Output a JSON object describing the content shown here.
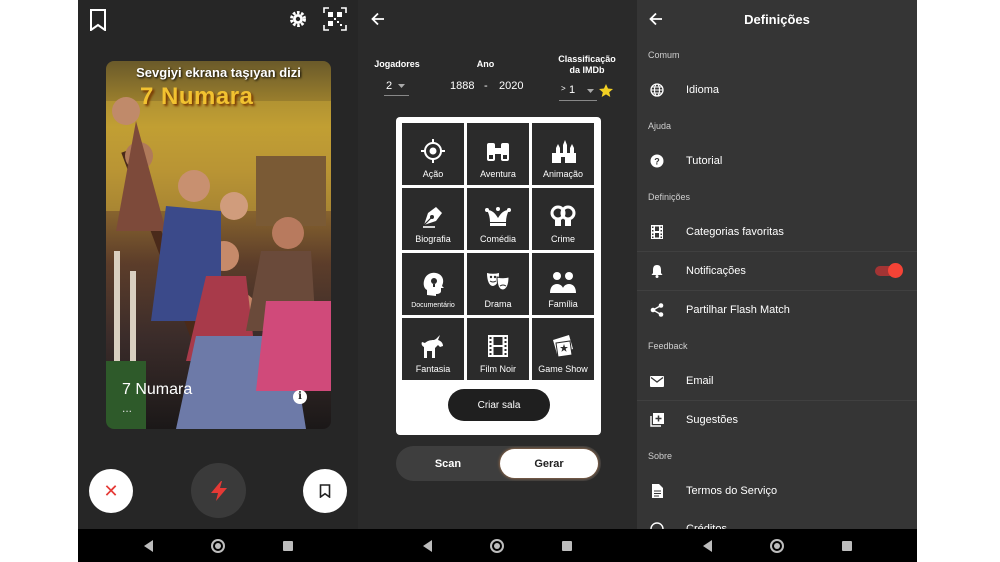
{
  "screen1": {
    "poster": {
      "tagline": "Sevgiyi ekrana taşıyan dizi",
      "logo": "7 Numara",
      "title": "7 Numara",
      "subtitle": "..."
    },
    "icons": [
      "bookmark-icon",
      "gear-icon",
      "qr-code-icon",
      "info-icon",
      "close-icon",
      "bolt-icon"
    ],
    "colors": {
      "reject": "#e53935",
      "bolt": "#e53935"
    }
  },
  "screen2": {
    "players": {
      "label": "Jogadores",
      "value": "2"
    },
    "year": {
      "label": "Ano",
      "from": "1888",
      "separator": "-",
      "to": "2020"
    },
    "rating": {
      "label_line1": "Classificação",
      "label_line2": "da IMDb",
      "prefix": ">",
      "value": "1"
    },
    "genres": [
      {
        "label": "Ação",
        "icon": "target-icon"
      },
      {
        "label": "Aventura",
        "icon": "binoculars-icon"
      },
      {
        "label": "Animação",
        "icon": "castle-icon"
      },
      {
        "label": "Biografia",
        "icon": "pen-nib-icon"
      },
      {
        "label": "Comédia",
        "icon": "jester-hat-icon"
      },
      {
        "label": "Crime",
        "icon": "handcuffs-icon"
      },
      {
        "label": "Documentário",
        "icon": "head-bulb-icon"
      },
      {
        "label": "Drama",
        "icon": "theater-masks-icon"
      },
      {
        "label": "Família",
        "icon": "family-icon"
      },
      {
        "label": "Fantasia",
        "icon": "unicorn-icon"
      },
      {
        "label": "Film Noir",
        "icon": "film-strip-icon"
      },
      {
        "label": "Game Show",
        "icon": "ticket-star-icon"
      }
    ],
    "create_button": "Criar sala",
    "tabs": {
      "scan": "Scan",
      "generate": "Gerar"
    },
    "colors": {
      "star": "#f2d024"
    }
  },
  "screen3": {
    "title": "Definições",
    "sections": {
      "comum": "Comum",
      "ajuda": "Ajuda",
      "definicoes": "Definições",
      "feedback": "Feedback",
      "sobre": "Sobre"
    },
    "items": {
      "idioma": "Idioma",
      "tutorial": "Tutorial",
      "categorias": "Categorias favoritas",
      "notificacoes": "Notificações",
      "partilhar": "Partilhar Flash Match",
      "email": "Email",
      "sugestoes": "Sugestões",
      "termos": "Termos do Serviço",
      "creditos": "Créditos"
    },
    "notifications_enabled": true,
    "colors": {
      "switch": "#f44336"
    }
  }
}
